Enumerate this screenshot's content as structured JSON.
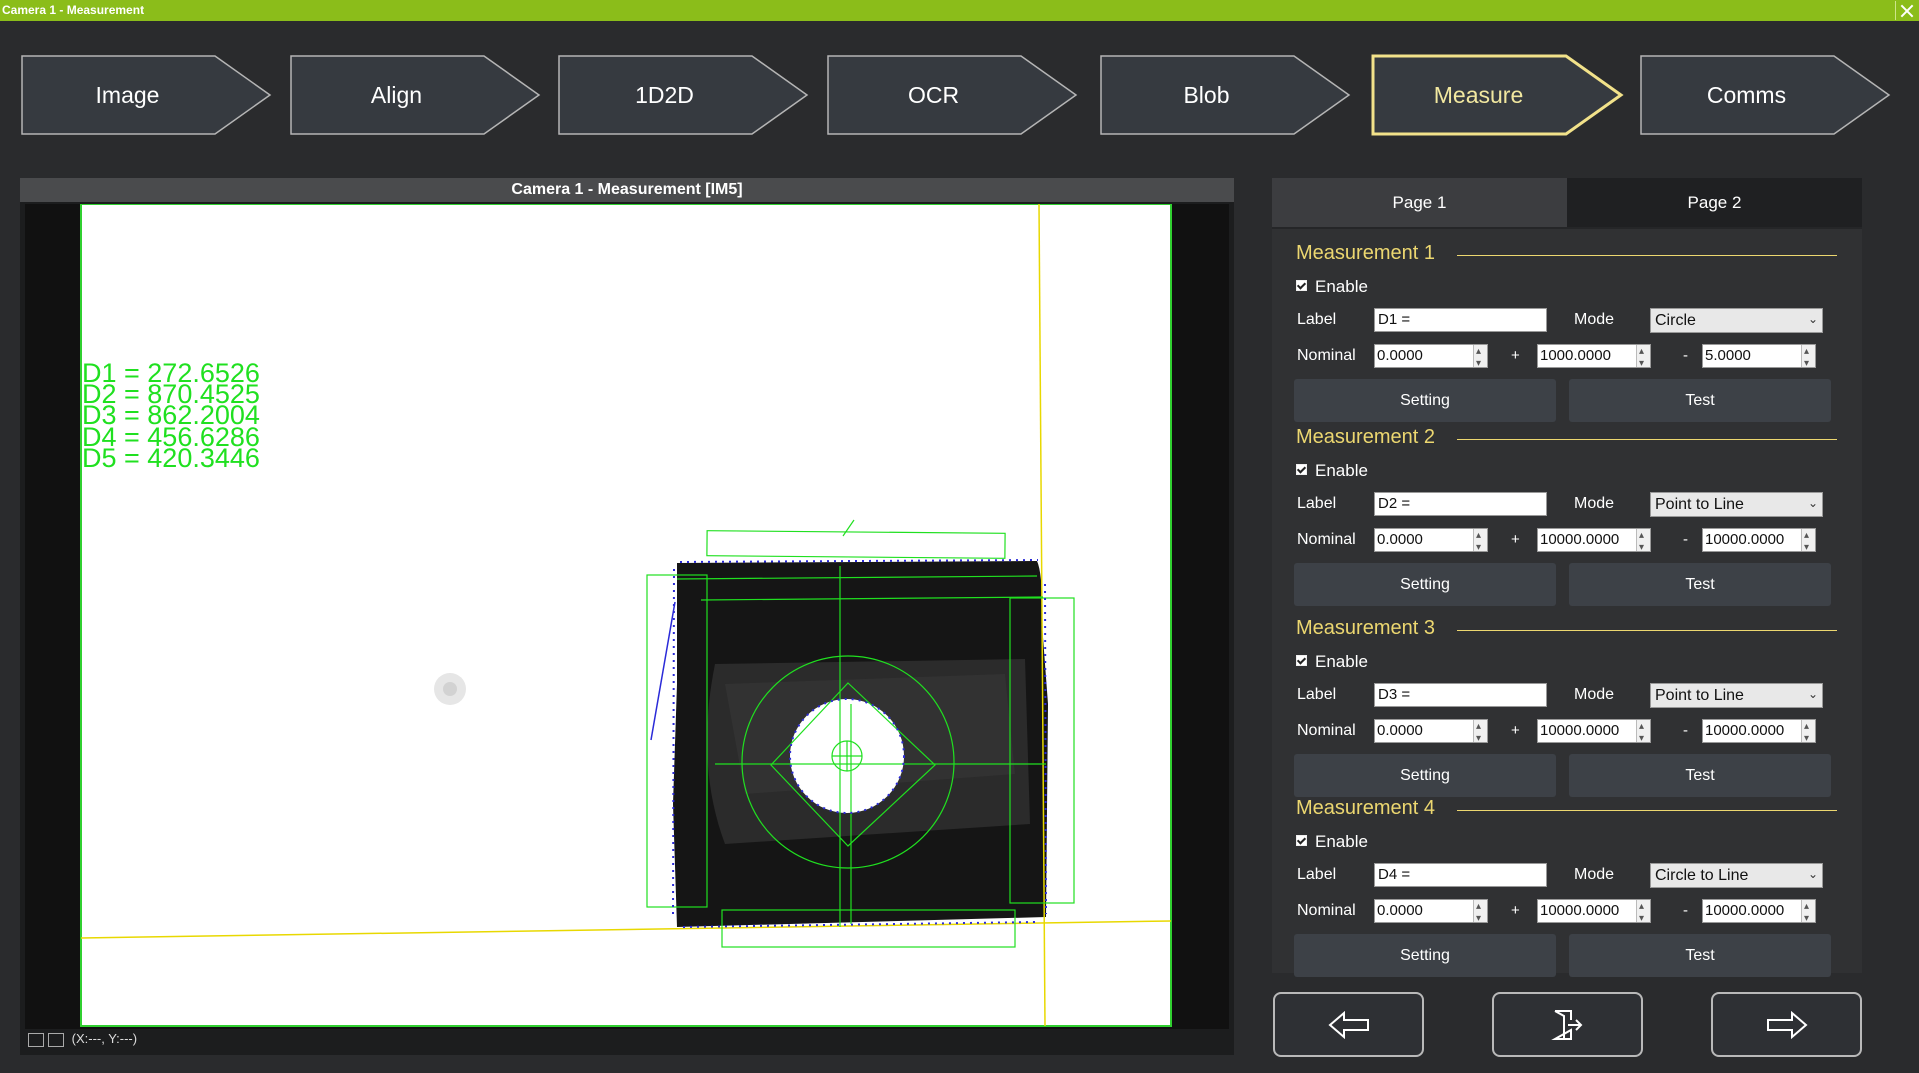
{
  "window": {
    "title": "Camera 1 - Measurement"
  },
  "steps": [
    {
      "label": "Image",
      "active": false
    },
    {
      "label": "Align",
      "active": false
    },
    {
      "label": "1D2D",
      "active": false
    },
    {
      "label": "OCR",
      "active": false
    },
    {
      "label": "Blob",
      "active": false
    },
    {
      "label": "Measure",
      "active": true
    },
    {
      "label": "Comms",
      "active": false
    }
  ],
  "viewer": {
    "title": "Camera 1 -  Measurement  [IM5]",
    "overlay_text": [
      "D1 = 272.6526",
      "D2 = 870.4525",
      "D3 = 862.2004",
      "D4 = 456.6286",
      "D5 = 420.3446"
    ],
    "coords": "(X:---, Y:---)",
    "overlay_color": "#20e020"
  },
  "panel": {
    "tabs": [
      "Page 1",
      "Page 2"
    ],
    "measurements": [
      {
        "title": "Measurement 1",
        "enable": "Enable",
        "label_caption": "Label",
        "label_value": "D1 =",
        "mode_caption": "Mode",
        "mode": "Circle",
        "nominal_caption": "Nominal",
        "nominal": "0.0000",
        "plus": "1000.0000",
        "minus": "5.0000",
        "setting": "Setting",
        "test": "Test"
      },
      {
        "title": "Measurement 2",
        "enable": "Enable",
        "label_caption": "Label",
        "label_value": "D2 =",
        "mode_caption": "Mode",
        "mode": "Point to Line",
        "nominal_caption": "Nominal",
        "nominal": "0.0000",
        "plus": "10000.0000",
        "minus": "10000.0000",
        "setting": "Setting",
        "test": "Test"
      },
      {
        "title": "Measurement 3",
        "enable": "Enable",
        "label_caption": "Label",
        "label_value": "D3 =",
        "mode_caption": "Mode",
        "mode": "Point to Line",
        "nominal_caption": "Nominal",
        "nominal": "0.0000",
        "plus": "10000.0000",
        "minus": "10000.0000",
        "setting": "Setting",
        "test": "Test"
      },
      {
        "title": "Measurement 4",
        "enable": "Enable",
        "label_caption": "Label",
        "label_value": "D4 =",
        "mode_caption": "Mode",
        "mode": "Circle to Line",
        "nominal_caption": "Nominal",
        "nominal": "0.0000",
        "plus": "10000.0000",
        "minus": "10000.0000",
        "setting": "Setting",
        "test": "Test"
      }
    ],
    "plus_sign": "+",
    "minus_sign": "-"
  },
  "bottom_nav": {
    "icons": [
      "arrow-left-icon",
      "exit-door-icon",
      "arrow-right-icon"
    ]
  },
  "colors": {
    "accent": "#8bbd1a",
    "section_heading": "#ecd770",
    "active_step_border": "#f2e28a"
  }
}
